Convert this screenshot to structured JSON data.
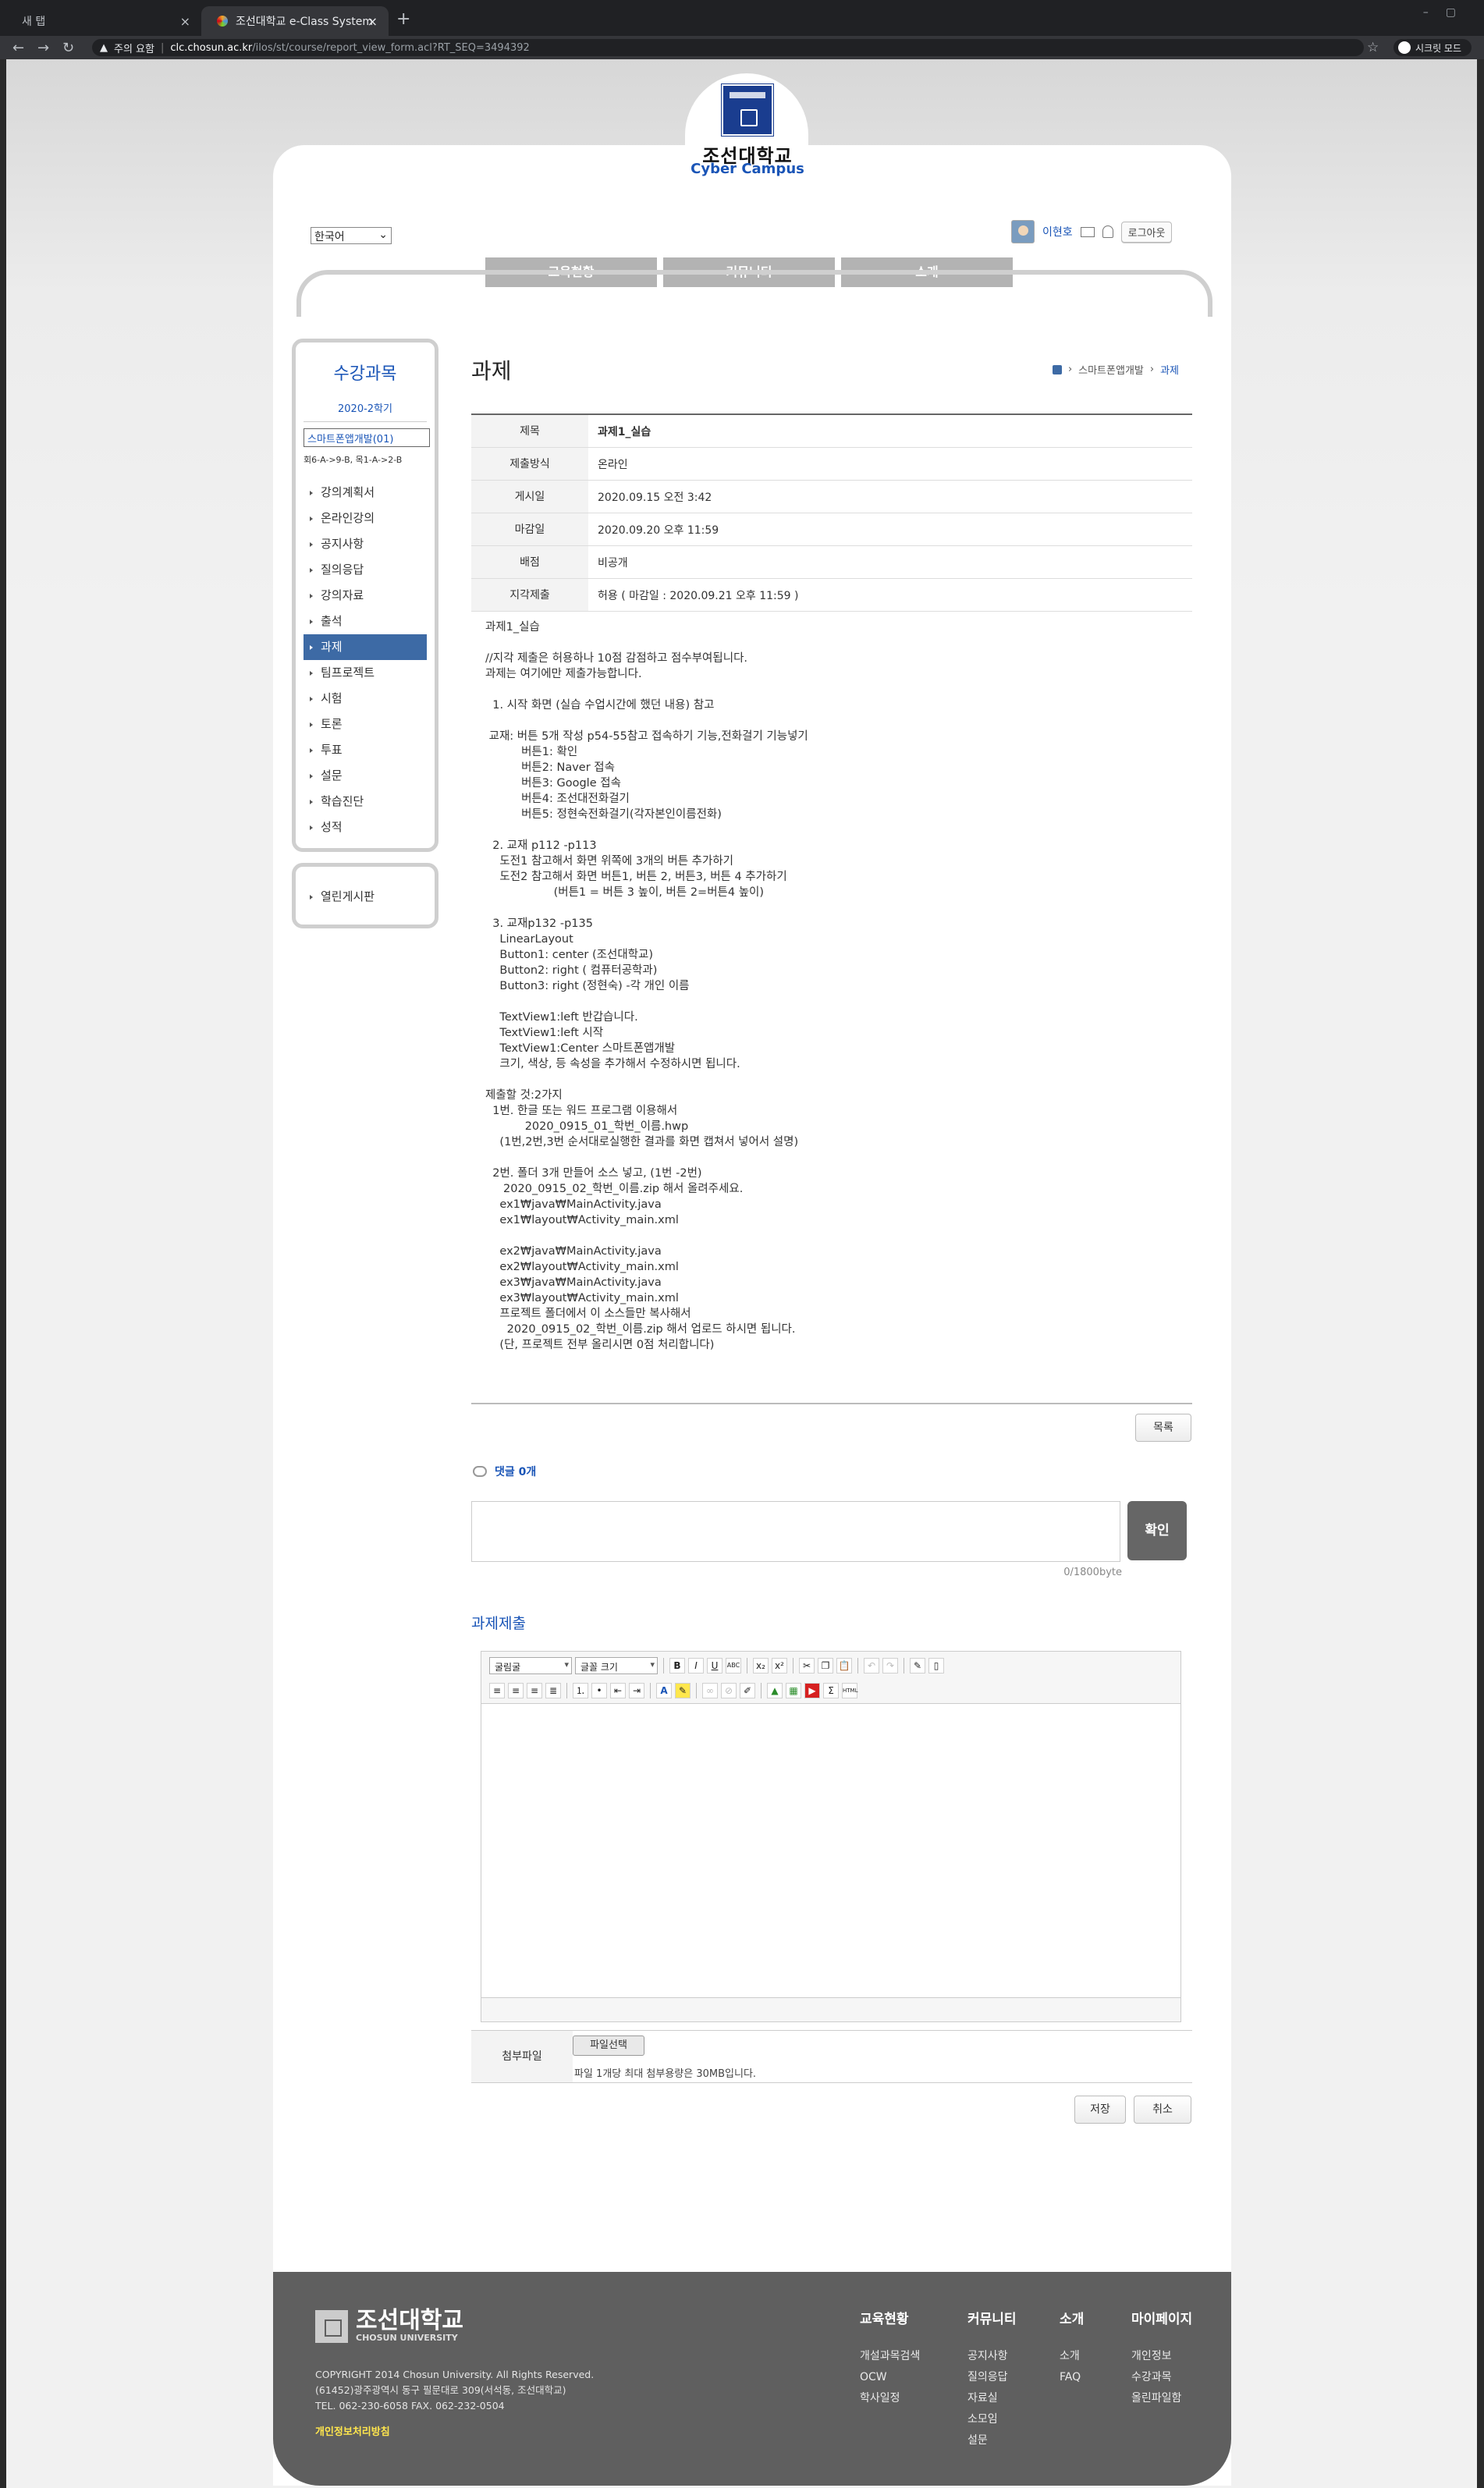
{
  "browser": {
    "tab1_title": "새 탭",
    "tab2_title": "조선대학교 e-Class System",
    "security_label": "주의 요함",
    "url_domain": "clc.chosun.ac.kr",
    "url_path": "/ilos/st/course/report_view_form.acl?RT_SEQ=3494392",
    "incognito_label": "시크릿 모드"
  },
  "header": {
    "brand_kr": "조선대학교",
    "brand_en": "Cyber Campus",
    "language": "한국어",
    "user_name": "이현호",
    "logout_label": "로그아웃",
    "nav": [
      "교육현황",
      "커뮤니티",
      "소개"
    ]
  },
  "sidebar": {
    "title": "수강과목",
    "semester": "2020-2학기",
    "course": "스마트폰앱개발(01)",
    "week_info": "회6-A->9-B, 목1-A->2-B",
    "items": [
      "강의계획서",
      "온라인강의",
      "공지사항",
      "질의응답",
      "강의자료",
      "출석",
      "과제",
      "팀프로젝트",
      "시험",
      "토론",
      "투표",
      "설문",
      "학습진단",
      "성적"
    ],
    "active_index": 6,
    "extra_item": "열린게시판"
  },
  "page": {
    "title": "과제",
    "breadcrumb": [
      "스마트폰앱개발",
      "과제"
    ]
  },
  "info": [
    {
      "label": "제목",
      "value": "과제1_실습",
      "bold": true
    },
    {
      "label": "제출방식",
      "value": "온라인"
    },
    {
      "label": "게시일",
      "value": "2020.09.15 오전 3:42"
    },
    {
      "label": "마감일",
      "value": "2020.09.20 오후 11:59"
    },
    {
      "label": "배점",
      "value": "비공개"
    },
    {
      "label": "지각제출",
      "value": "허용    ( 마감일 : 2020.09.21 오후 11:59 )"
    }
  ],
  "body_text": "과제1_실습\n\n//지각 제출은 허용하나 10점 감점하고 점수부여됩니다.\n과제는 여기에만 제출가능합니다.\n\n  1. 시작 화면 (실습 수업시간에 했던 내용) 참고\n\n 교재: 버튼 5개 작성 p54-55참고 접속하기 기능,전화걸기 기능넣기\n          버튼1: 확인\n          버튼2: Naver 접속\n          버튼3: Google 접속\n          버튼4: 조선대전화걸기\n          버튼5: 정현숙전화걸기(각자본인이름전화)\n\n  2. 교재 p112 -p113\n    도전1 참고해서 화면 위쪽에 3개의 버튼 추가하기\n    도전2 참고해서 화면 버튼1, 버튼 2, 버튼3, 버튼 4 추가하기\n                   (버튼1 = 버튼 3 높이, 버튼 2=버튼4 높이)\n\n  3. 교재p132 -p135\n    LinearLayout\n    Button1: center (조선대학교)\n    Button2: right ( 컴퓨터공학과)\n    Button3: right (정현숙) -각 개인 이름\n\n    TextView1:left 반갑습니다.\n    TextView1:left 시작\n    TextView1:Center 스마트폰앱개발\n    크기, 색상, 등 속성을 추가해서 수정하시면 됩니다.\n\n제출할 것:2가지\n  1번. 한글 또는 워드 프로그램 이용해서\n           2020_0915_01_학번_이름.hwp\n    (1번,2번,3번 순서대로실행한 결과를 화면 캡쳐서 넣어서 설명)\n\n  2번. 폴더 3개 만들어 소스 넣고, (1번 -2번)\n     2020_0915_02_학번_이름.zip 해서 올려주세요.\n    ex1₩java₩MainActivity.java\n    ex1₩layout₩Activity_main.xml\n\n    ex2₩java₩MainActivity.java\n    ex2₩layout₩Activity_main.xml\n    ex3₩java₩MainActivity.java\n    ex3₩layout₩Activity_main.xml\n    프로젝트 폴더에서 이 소스들만 복사해서\n      2020_0915_02_학번_이름.zip 해서 업로드 하시면 됩니다.\n    (단, 프로젝트 전부 올리시면 0점 처리합니다)",
  "buttons": {
    "list": "목록",
    "confirm": "확인",
    "file_select": "파일선택",
    "save": "저장",
    "cancel": "취소"
  },
  "comments": {
    "label": "댓글 0개",
    "byte_counter": "0/1800byte"
  },
  "submission": {
    "title": "과제제출",
    "font_family": "굴림굴",
    "font_size": "글꼴 크기",
    "attach_label": "첨부파일",
    "attach_note": "파일 1개당 최대 첨부용량은 30MB입니다."
  },
  "footer": {
    "logo_kr": "조선대학교",
    "logo_en": "CHOSUN UNIVERSITY",
    "copyright": "COPYRIGHT 2014 Chosun University. All Rights Reserved.",
    "address": "(61452)광주광역시 동구 필문대로 309(서석동, 조선대학교)",
    "tel": "TEL. 062-230-6058 FAX. 062-232-0504",
    "privacy": "개인정보처리방침",
    "columns": [
      {
        "title": "교육현황",
        "links": [
          "개설과목검색",
          "OCW",
          "학사일정"
        ]
      },
      {
        "title": "커뮤니티",
        "links": [
          "공지사항",
          "질의응답",
          "자료실",
          "소모임",
          "설문"
        ]
      },
      {
        "title": "소개",
        "links": [
          "소개",
          "FAQ"
        ]
      },
      {
        "title": "마이페이지",
        "links": [
          "개인정보",
          "수강과목",
          "올린파일함"
        ]
      }
    ]
  }
}
